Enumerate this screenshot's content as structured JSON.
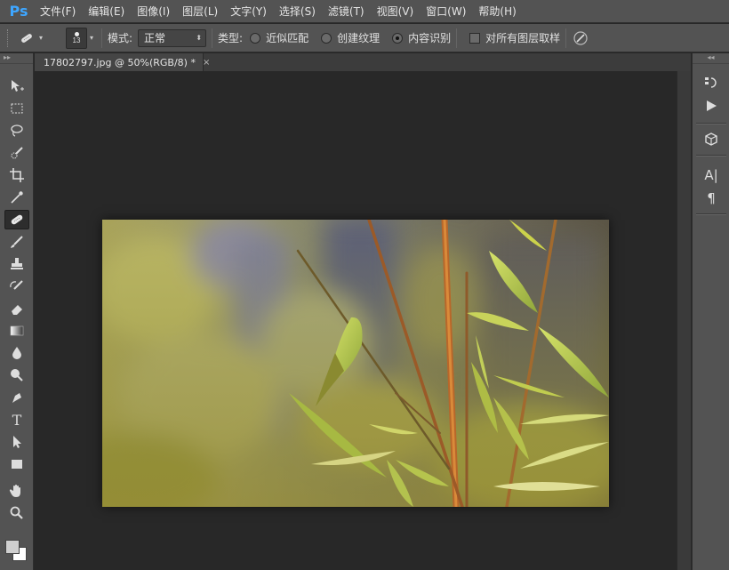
{
  "app": {
    "logo": "Ps"
  },
  "menu": [
    "文件(F)",
    "编辑(E)",
    "图像(I)",
    "图层(L)",
    "文字(Y)",
    "选择(S)",
    "滤镜(T)",
    "视图(V)",
    "窗口(W)",
    "帮助(H)"
  ],
  "options": {
    "brush_size": "13",
    "mode_label": "模式:",
    "mode_value": "正常",
    "type_label": "类型:",
    "radio_1": "近似匹配",
    "radio_2": "创建纹理",
    "radio_3": "内容识别",
    "selected_radio": "内容识别",
    "checkbox_label": "对所有图层取样"
  },
  "document": {
    "tab_title": "17802797.jpg @ 50%(RGB/8) *",
    "close_symbol": "×"
  },
  "tools": [
    "move-tool-icon",
    "marquee-tool-icon",
    "lasso-tool-icon",
    "quick-selection-tool-icon",
    "crop-tool-icon",
    "eyedropper-tool-icon",
    "spot-healing-brush-tool-icon",
    "brush-tool-icon",
    "clone-stamp-tool-icon",
    "history-brush-tool-icon",
    "eraser-tool-icon",
    "gradient-tool-icon",
    "blur-tool-icon",
    "dodge-tool-icon",
    "pen-tool-icon",
    "type-tool-icon",
    "path-selection-tool-icon",
    "rectangle-tool-icon",
    "hand-tool-icon",
    "zoom-tool-icon"
  ],
  "active_tool": "spot-healing-brush-tool-icon",
  "right_panel": [
    "history-icon",
    "actions-play-icon",
    "3d-icon",
    "character-icon",
    "paragraph-icon"
  ],
  "colors": {
    "accent": "#3ea6ff",
    "foreground": "#cfcfcf",
    "background": "#ffffff",
    "ui_bg": "#535353",
    "workspace": "#282828"
  }
}
